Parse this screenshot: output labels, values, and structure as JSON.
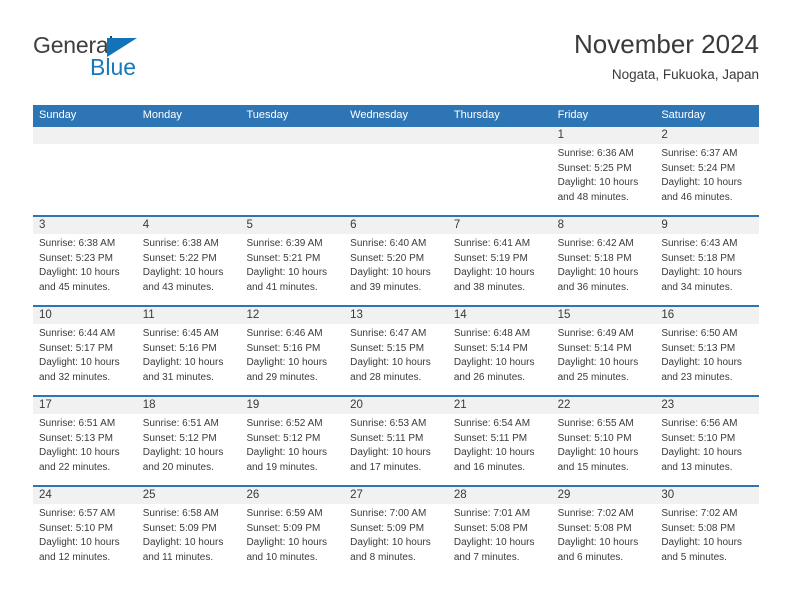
{
  "logo": {
    "word_one": "General",
    "word_two": "Blue",
    "triangle_icon": "triangle-icon",
    "brand_blue": "#1878bd",
    "brand_dark": "#3f3f3f"
  },
  "header": {
    "title": "November 2024",
    "subtitle": "Nogata, Fukuoka, Japan"
  },
  "theme": {
    "header_bg": "#2e75b6",
    "header_text": "#ffffff",
    "numband_bg": "#f1f1f1",
    "body_text": "#3b3b3b"
  },
  "weekdays": [
    "Sunday",
    "Monday",
    "Tuesday",
    "Wednesday",
    "Thursday",
    "Friday",
    "Saturday"
  ],
  "weeks": [
    [
      {
        "day": "",
        "sunrise": "",
        "sunset": "",
        "daylight_line1": "",
        "daylight_line2": ""
      },
      {
        "day": "",
        "sunrise": "",
        "sunset": "",
        "daylight_line1": "",
        "daylight_line2": ""
      },
      {
        "day": "",
        "sunrise": "",
        "sunset": "",
        "daylight_line1": "",
        "daylight_line2": ""
      },
      {
        "day": "",
        "sunrise": "",
        "sunset": "",
        "daylight_line1": "",
        "daylight_line2": ""
      },
      {
        "day": "",
        "sunrise": "",
        "sunset": "",
        "daylight_line1": "",
        "daylight_line2": ""
      },
      {
        "day": "1",
        "sunrise": "Sunrise: 6:36 AM",
        "sunset": "Sunset: 5:25 PM",
        "daylight_line1": "Daylight: 10 hours",
        "daylight_line2": "and 48 minutes."
      },
      {
        "day": "2",
        "sunrise": "Sunrise: 6:37 AM",
        "sunset": "Sunset: 5:24 PM",
        "daylight_line1": "Daylight: 10 hours",
        "daylight_line2": "and 46 minutes."
      }
    ],
    [
      {
        "day": "3",
        "sunrise": "Sunrise: 6:38 AM",
        "sunset": "Sunset: 5:23 PM",
        "daylight_line1": "Daylight: 10 hours",
        "daylight_line2": "and 45 minutes."
      },
      {
        "day": "4",
        "sunrise": "Sunrise: 6:38 AM",
        "sunset": "Sunset: 5:22 PM",
        "daylight_line1": "Daylight: 10 hours",
        "daylight_line2": "and 43 minutes."
      },
      {
        "day": "5",
        "sunrise": "Sunrise: 6:39 AM",
        "sunset": "Sunset: 5:21 PM",
        "daylight_line1": "Daylight: 10 hours",
        "daylight_line2": "and 41 minutes."
      },
      {
        "day": "6",
        "sunrise": "Sunrise: 6:40 AM",
        "sunset": "Sunset: 5:20 PM",
        "daylight_line1": "Daylight: 10 hours",
        "daylight_line2": "and 39 minutes."
      },
      {
        "day": "7",
        "sunrise": "Sunrise: 6:41 AM",
        "sunset": "Sunset: 5:19 PM",
        "daylight_line1": "Daylight: 10 hours",
        "daylight_line2": "and 38 minutes."
      },
      {
        "day": "8",
        "sunrise": "Sunrise: 6:42 AM",
        "sunset": "Sunset: 5:18 PM",
        "daylight_line1": "Daylight: 10 hours",
        "daylight_line2": "and 36 minutes."
      },
      {
        "day": "9",
        "sunrise": "Sunrise: 6:43 AM",
        "sunset": "Sunset: 5:18 PM",
        "daylight_line1": "Daylight: 10 hours",
        "daylight_line2": "and 34 minutes."
      }
    ],
    [
      {
        "day": "10",
        "sunrise": "Sunrise: 6:44 AM",
        "sunset": "Sunset: 5:17 PM",
        "daylight_line1": "Daylight: 10 hours",
        "daylight_line2": "and 32 minutes."
      },
      {
        "day": "11",
        "sunrise": "Sunrise: 6:45 AM",
        "sunset": "Sunset: 5:16 PM",
        "daylight_line1": "Daylight: 10 hours",
        "daylight_line2": "and 31 minutes."
      },
      {
        "day": "12",
        "sunrise": "Sunrise: 6:46 AM",
        "sunset": "Sunset: 5:16 PM",
        "daylight_line1": "Daylight: 10 hours",
        "daylight_line2": "and 29 minutes."
      },
      {
        "day": "13",
        "sunrise": "Sunrise: 6:47 AM",
        "sunset": "Sunset: 5:15 PM",
        "daylight_line1": "Daylight: 10 hours",
        "daylight_line2": "and 28 minutes."
      },
      {
        "day": "14",
        "sunrise": "Sunrise: 6:48 AM",
        "sunset": "Sunset: 5:14 PM",
        "daylight_line1": "Daylight: 10 hours",
        "daylight_line2": "and 26 minutes."
      },
      {
        "day": "15",
        "sunrise": "Sunrise: 6:49 AM",
        "sunset": "Sunset: 5:14 PM",
        "daylight_line1": "Daylight: 10 hours",
        "daylight_line2": "and 25 minutes."
      },
      {
        "day": "16",
        "sunrise": "Sunrise: 6:50 AM",
        "sunset": "Sunset: 5:13 PM",
        "daylight_line1": "Daylight: 10 hours",
        "daylight_line2": "and 23 minutes."
      }
    ],
    [
      {
        "day": "17",
        "sunrise": "Sunrise: 6:51 AM",
        "sunset": "Sunset: 5:13 PM",
        "daylight_line1": "Daylight: 10 hours",
        "daylight_line2": "and 22 minutes."
      },
      {
        "day": "18",
        "sunrise": "Sunrise: 6:51 AM",
        "sunset": "Sunset: 5:12 PM",
        "daylight_line1": "Daylight: 10 hours",
        "daylight_line2": "and 20 minutes."
      },
      {
        "day": "19",
        "sunrise": "Sunrise: 6:52 AM",
        "sunset": "Sunset: 5:12 PM",
        "daylight_line1": "Daylight: 10 hours",
        "daylight_line2": "and 19 minutes."
      },
      {
        "day": "20",
        "sunrise": "Sunrise: 6:53 AM",
        "sunset": "Sunset: 5:11 PM",
        "daylight_line1": "Daylight: 10 hours",
        "daylight_line2": "and 17 minutes."
      },
      {
        "day": "21",
        "sunrise": "Sunrise: 6:54 AM",
        "sunset": "Sunset: 5:11 PM",
        "daylight_line1": "Daylight: 10 hours",
        "daylight_line2": "and 16 minutes."
      },
      {
        "day": "22",
        "sunrise": "Sunrise: 6:55 AM",
        "sunset": "Sunset: 5:10 PM",
        "daylight_line1": "Daylight: 10 hours",
        "daylight_line2": "and 15 minutes."
      },
      {
        "day": "23",
        "sunrise": "Sunrise: 6:56 AM",
        "sunset": "Sunset: 5:10 PM",
        "daylight_line1": "Daylight: 10 hours",
        "daylight_line2": "and 13 minutes."
      }
    ],
    [
      {
        "day": "24",
        "sunrise": "Sunrise: 6:57 AM",
        "sunset": "Sunset: 5:10 PM",
        "daylight_line1": "Daylight: 10 hours",
        "daylight_line2": "and 12 minutes."
      },
      {
        "day": "25",
        "sunrise": "Sunrise: 6:58 AM",
        "sunset": "Sunset: 5:09 PM",
        "daylight_line1": "Daylight: 10 hours",
        "daylight_line2": "and 11 minutes."
      },
      {
        "day": "26",
        "sunrise": "Sunrise: 6:59 AM",
        "sunset": "Sunset: 5:09 PM",
        "daylight_line1": "Daylight: 10 hours",
        "daylight_line2": "and 10 minutes."
      },
      {
        "day": "27",
        "sunrise": "Sunrise: 7:00 AM",
        "sunset": "Sunset: 5:09 PM",
        "daylight_line1": "Daylight: 10 hours",
        "daylight_line2": "and 8 minutes."
      },
      {
        "day": "28",
        "sunrise": "Sunrise: 7:01 AM",
        "sunset": "Sunset: 5:08 PM",
        "daylight_line1": "Daylight: 10 hours",
        "daylight_line2": "and 7 minutes."
      },
      {
        "day": "29",
        "sunrise": "Sunrise: 7:02 AM",
        "sunset": "Sunset: 5:08 PM",
        "daylight_line1": "Daylight: 10 hours",
        "daylight_line2": "and 6 minutes."
      },
      {
        "day": "30",
        "sunrise": "Sunrise: 7:02 AM",
        "sunset": "Sunset: 5:08 PM",
        "daylight_line1": "Daylight: 10 hours",
        "daylight_line2": "and 5 minutes."
      }
    ]
  ]
}
